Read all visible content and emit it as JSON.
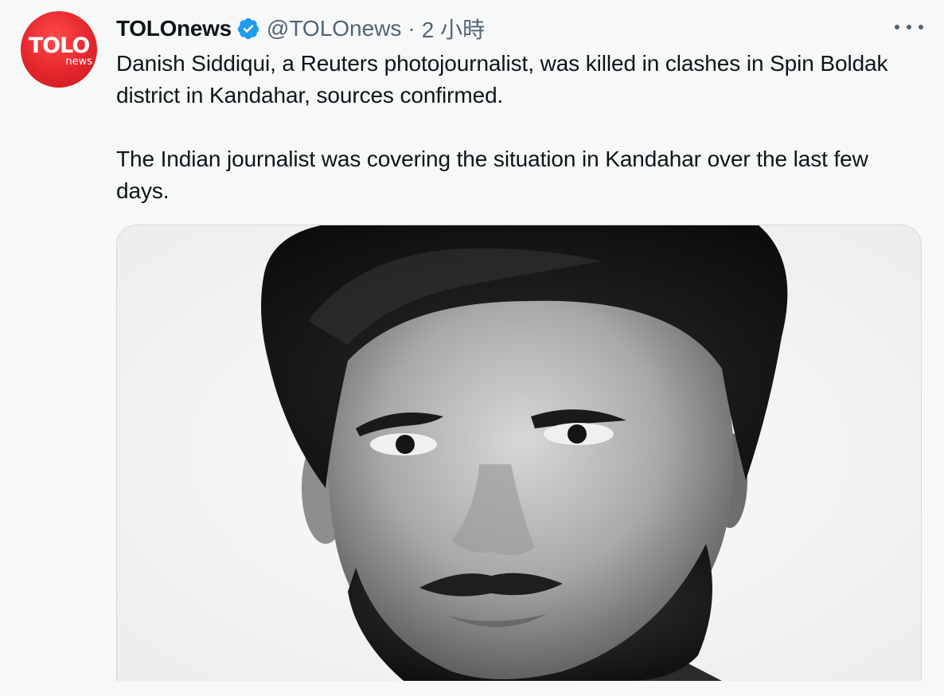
{
  "author": {
    "display_name": "TOLOnews",
    "handle": "@TOLOnews",
    "separator": "·",
    "timestamp": "2 小時",
    "verified": true,
    "avatar_logo_main": "TOLO",
    "avatar_logo_sub": "news"
  },
  "tweet": {
    "paragraphs": [
      "Danish Siddiqui, a Reuters photojournalist, was killed in clashes in Spin Boldak district in Kandahar, sources confirmed.",
      "The Indian journalist was covering the situation in Kandahar over the last few days."
    ]
  },
  "media": {
    "kind": "photo",
    "style": "black-and-white portrait"
  },
  "colors": {
    "background": "#f7f9f9",
    "text_primary": "#0f1419",
    "text_secondary": "#536471",
    "verified_badge": "#1d9bf0",
    "avatar_red": "#e3262c",
    "media_border": "#cfd9de"
  }
}
